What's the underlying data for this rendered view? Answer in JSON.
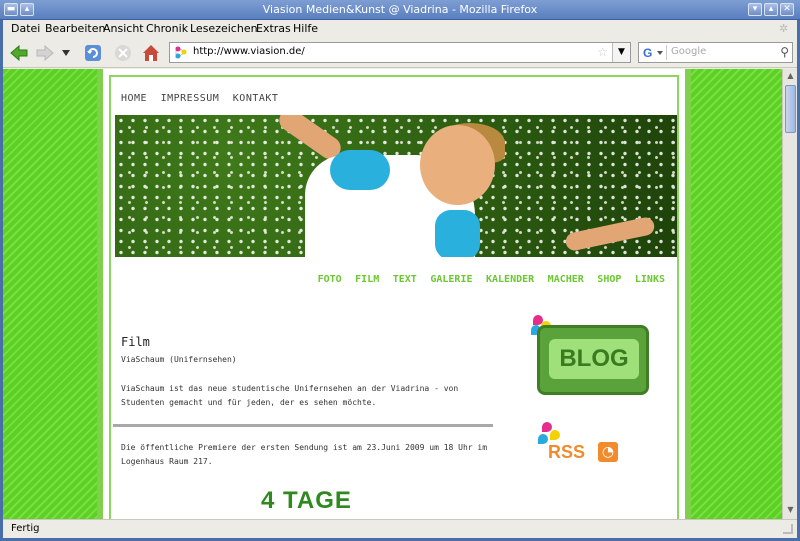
{
  "window": {
    "title": "Viasion Medien&Kunst @ Viadrina - Mozilla Firefox"
  },
  "menu": {
    "items": [
      {
        "label": "Datei"
      },
      {
        "label": "Bearbeiten"
      },
      {
        "label": "Ansicht"
      },
      {
        "label": "Chronik"
      },
      {
        "label": "Lesezeichen"
      },
      {
        "label": "Extras"
      },
      {
        "label": "Hilfe"
      }
    ]
  },
  "toolbar": {
    "url": "http://www.viasion.de/",
    "search_placeholder": "Google",
    "icons": [
      "back-icon",
      "forward-icon",
      "history-dropdown-icon",
      "reload-icon",
      "stop-icon",
      "home-icon"
    ]
  },
  "site": {
    "topnav": [
      "HOME",
      "IMPRESSUM",
      "KONTAKT"
    ],
    "subnav": [
      "FOTO",
      "FILM",
      "TEXT",
      "GALERIE",
      "KALENDER",
      "MACHER",
      "SHOP",
      "LINKS"
    ],
    "heading": "Film",
    "subheading": "ViaSchaum (Unifernsehen)",
    "para1": "ViaSchaum ist das neue studentische Unifernsehen an der Viadrina - von Studenten gemacht und für jeden, der es sehen möchte.",
    "para2": "Die öffentliche Premiere der ersten Sendung ist am 23.Juni 2009 um 18 Uhr im Logenhaus Raum 217.",
    "banner_text": "4 TAGE",
    "blog_label": "BLOG",
    "rss_label": "RSS",
    "accent_color": "#6cc832"
  },
  "status": {
    "text": "Fertig"
  }
}
